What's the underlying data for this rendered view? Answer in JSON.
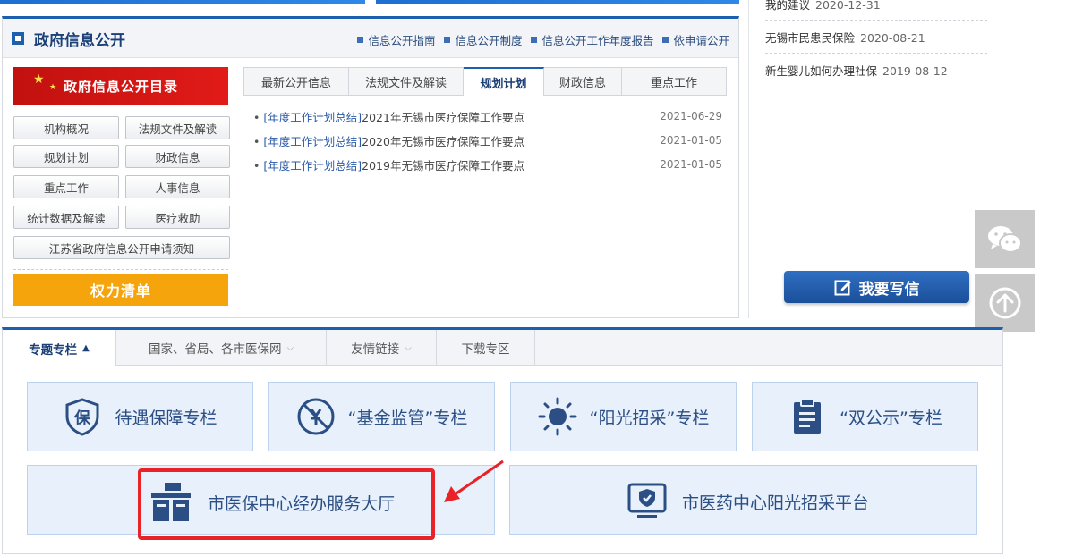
{
  "gov_info": {
    "title": "政府信息公开",
    "links": [
      "信息公开指南",
      "信息公开制度",
      "信息公开工作年度报告",
      "依申请公开"
    ]
  },
  "catalog": {
    "title": "政府信息公开目录",
    "buttons": [
      "机构概况",
      "法规文件及解读",
      "规划计划",
      "财政信息",
      "重点工作",
      "人事信息",
      "统计数据及解读",
      "医疗救助",
      "江苏省政府信息公开申请须知"
    ],
    "power_list": "权力清单"
  },
  "news": {
    "tabs": [
      "最新公开信息",
      "法规文件及解读",
      "规划计划",
      "财政信息",
      "重点工作"
    ],
    "active_tab": "规划计划",
    "items": [
      {
        "category": "[年度工作计划总结]",
        "title": "2021年无锡市医疗保障工作要点",
        "date": "2021-06-29"
      },
      {
        "category": "[年度工作计划总结]",
        "title": "2020年无锡市医疗保障工作要点",
        "date": "2021-01-05"
      },
      {
        "category": "[年度工作计划总结]",
        "title": "2019年无锡市医疗保障工作要点",
        "date": "2021-01-05"
      }
    ]
  },
  "right_list": {
    "items": [
      {
        "title": "我的建议",
        "date": "2020-12-31"
      },
      {
        "title": "无锡市民患民保险",
        "date": "2020-08-21"
      },
      {
        "title": "新生婴儿如何办理社保",
        "date": "2019-08-12"
      }
    ],
    "write_letter": "我要写信"
  },
  "special": {
    "tabs": [
      "专题专栏",
      "国家、省局、各市医保网",
      "友情链接",
      "下载专区"
    ],
    "tiles_row1": [
      "待遇保障专栏",
      "“基金监管”专栏",
      "“阳光招采”专栏",
      "“双公示”专栏"
    ],
    "tiles_row2": [
      "市医保中心经办服务大厅",
      "市医药中心阳光招采平台"
    ]
  },
  "colors": {
    "brand_blue": "#1b5fae",
    "catalog_red": "#d41512",
    "power_orange": "#f6a40c",
    "tile_bg": "#e7f0fb",
    "highlight_red": "#e82227"
  }
}
